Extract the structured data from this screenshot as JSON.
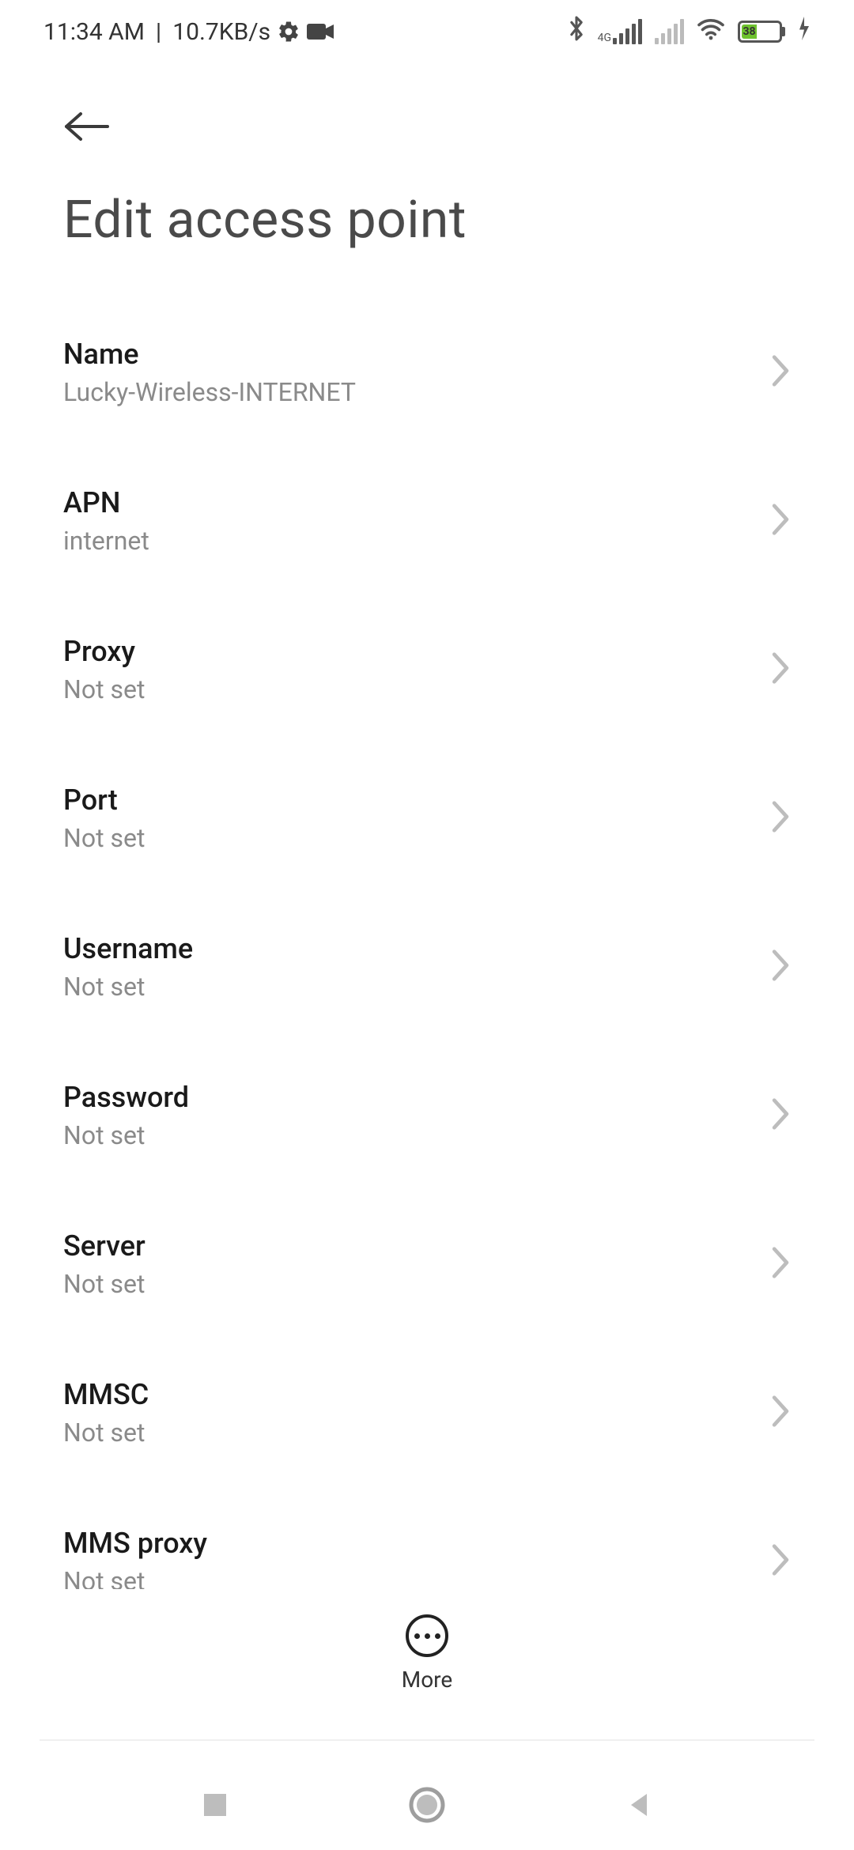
{
  "status": {
    "time": "11:34 AM",
    "net_speed": "10.7KB/s",
    "battery_percent": "38",
    "sig_label": "4G"
  },
  "header": {
    "title": "Edit access point"
  },
  "settings": [
    {
      "label": "Name",
      "value": "Lucky-Wireless-INTERNET"
    },
    {
      "label": "APN",
      "value": "internet"
    },
    {
      "label": "Proxy",
      "value": "Not set"
    },
    {
      "label": "Port",
      "value": "Not set"
    },
    {
      "label": "Username",
      "value": "Not set"
    },
    {
      "label": "Password",
      "value": "Not set"
    },
    {
      "label": "Server",
      "value": "Not set"
    },
    {
      "label": "MMSC",
      "value": "Not set"
    },
    {
      "label": "MMS proxy",
      "value": "Not set"
    }
  ],
  "footer": {
    "more_label": "More"
  }
}
